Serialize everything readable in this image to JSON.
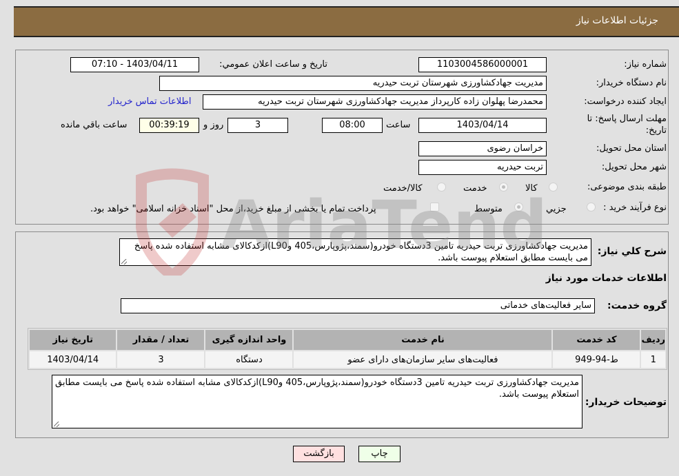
{
  "header": {
    "title": "جزئیات اطلاعات نیاز"
  },
  "form": {
    "need_number": {
      "label": "شماره نیاز:",
      "value": "1103004586000001"
    },
    "announce_datetime": {
      "label": "تاریخ و ساعت اعلان عمومي:",
      "value": "1403/04/11 - 07:10"
    },
    "buyer_org": {
      "label": "نام دستگاه خریدار:",
      "value": "مدیریت جهادکشاورزی شهرستان تربت حیدریه"
    },
    "requester": {
      "label": "ایجاد کننده درخواست:",
      "value": "محمدرضا پهلوان زاده کارپرداز مدیریت جهادکشاورزی شهرستان تربت حیدریه",
      "contact_link": "اطلاعات تماس خریدار"
    },
    "deadline": {
      "label_line1": "مهلت ارسال پاسخ: تا",
      "label_line2": "تاریخ:",
      "date": "1403/04/14",
      "time_label": "ساعت",
      "time": "08:00",
      "days": "3",
      "days_label": "روز و",
      "remaining": "00:39:19",
      "remaining_label": "ساعت باقي مانده"
    },
    "province": {
      "label": "استان محل تحویل:",
      "value": "خراسان رضوی"
    },
    "city": {
      "label": "شهر محل تحویل:",
      "value": "تربت حیدریه"
    },
    "category": {
      "label": "طبقه بندی موضوعی:",
      "options": [
        "کالا",
        "خدمت",
        "کالا/خدمت"
      ],
      "selected": "خدمت"
    },
    "purchase_type": {
      "label": "نوع فرآیند خرید :",
      "options": [
        "جزیي",
        "متوسط"
      ],
      "selected": "متوسط",
      "treasury_note": "پرداخت تمام یا بخشی از مبلغ خرید،از محل \"اسناد خزانه اسلامی\" خواهد بود."
    }
  },
  "details": {
    "general_desc_label": "شرح کلي نیاز:",
    "general_desc": "مدیریت جهادکشاورزی تربت حیدریه تامین 3دستگاه خودرو(سمند،پژوپارس،405 وL90)ازکدکالای مشابه استفاده شده پاسخ می بایست مطابق استعلام پیوست باشد.",
    "services_heading": "اطلاعات خدمات مورد نیاز",
    "service_group_label": "گروه خدمت:",
    "service_group": "سایر فعالیت‌های خدماتی",
    "table": {
      "headers": [
        "ردیف",
        "کد خدمت",
        "نام خدمت",
        "واحد اندازه گیری",
        "تعداد / مقدار",
        "تاریخ نیاز"
      ],
      "rows": [
        [
          "1",
          "ط-94-949",
          "فعالیت‌های سایر سازمان‌های دارای عضو",
          "دستگاه",
          "3",
          "1403/04/14"
        ]
      ]
    },
    "buyer_notes_label": "توضیحات خریدار:",
    "buyer_notes": "مدیریت جهادکشاورزی تربت حیدریه تامین 3دستگاه خودرو(سمند،پژوپارس،405 وL90)ازکدکالای مشابه استفاده شده پاسخ می بایست مطابق استعلام پیوست باشد."
  },
  "buttons": {
    "print": "چاپ",
    "back": "بازگشت"
  },
  "watermark": {
    "text": "AriaTender.neT"
  }
}
